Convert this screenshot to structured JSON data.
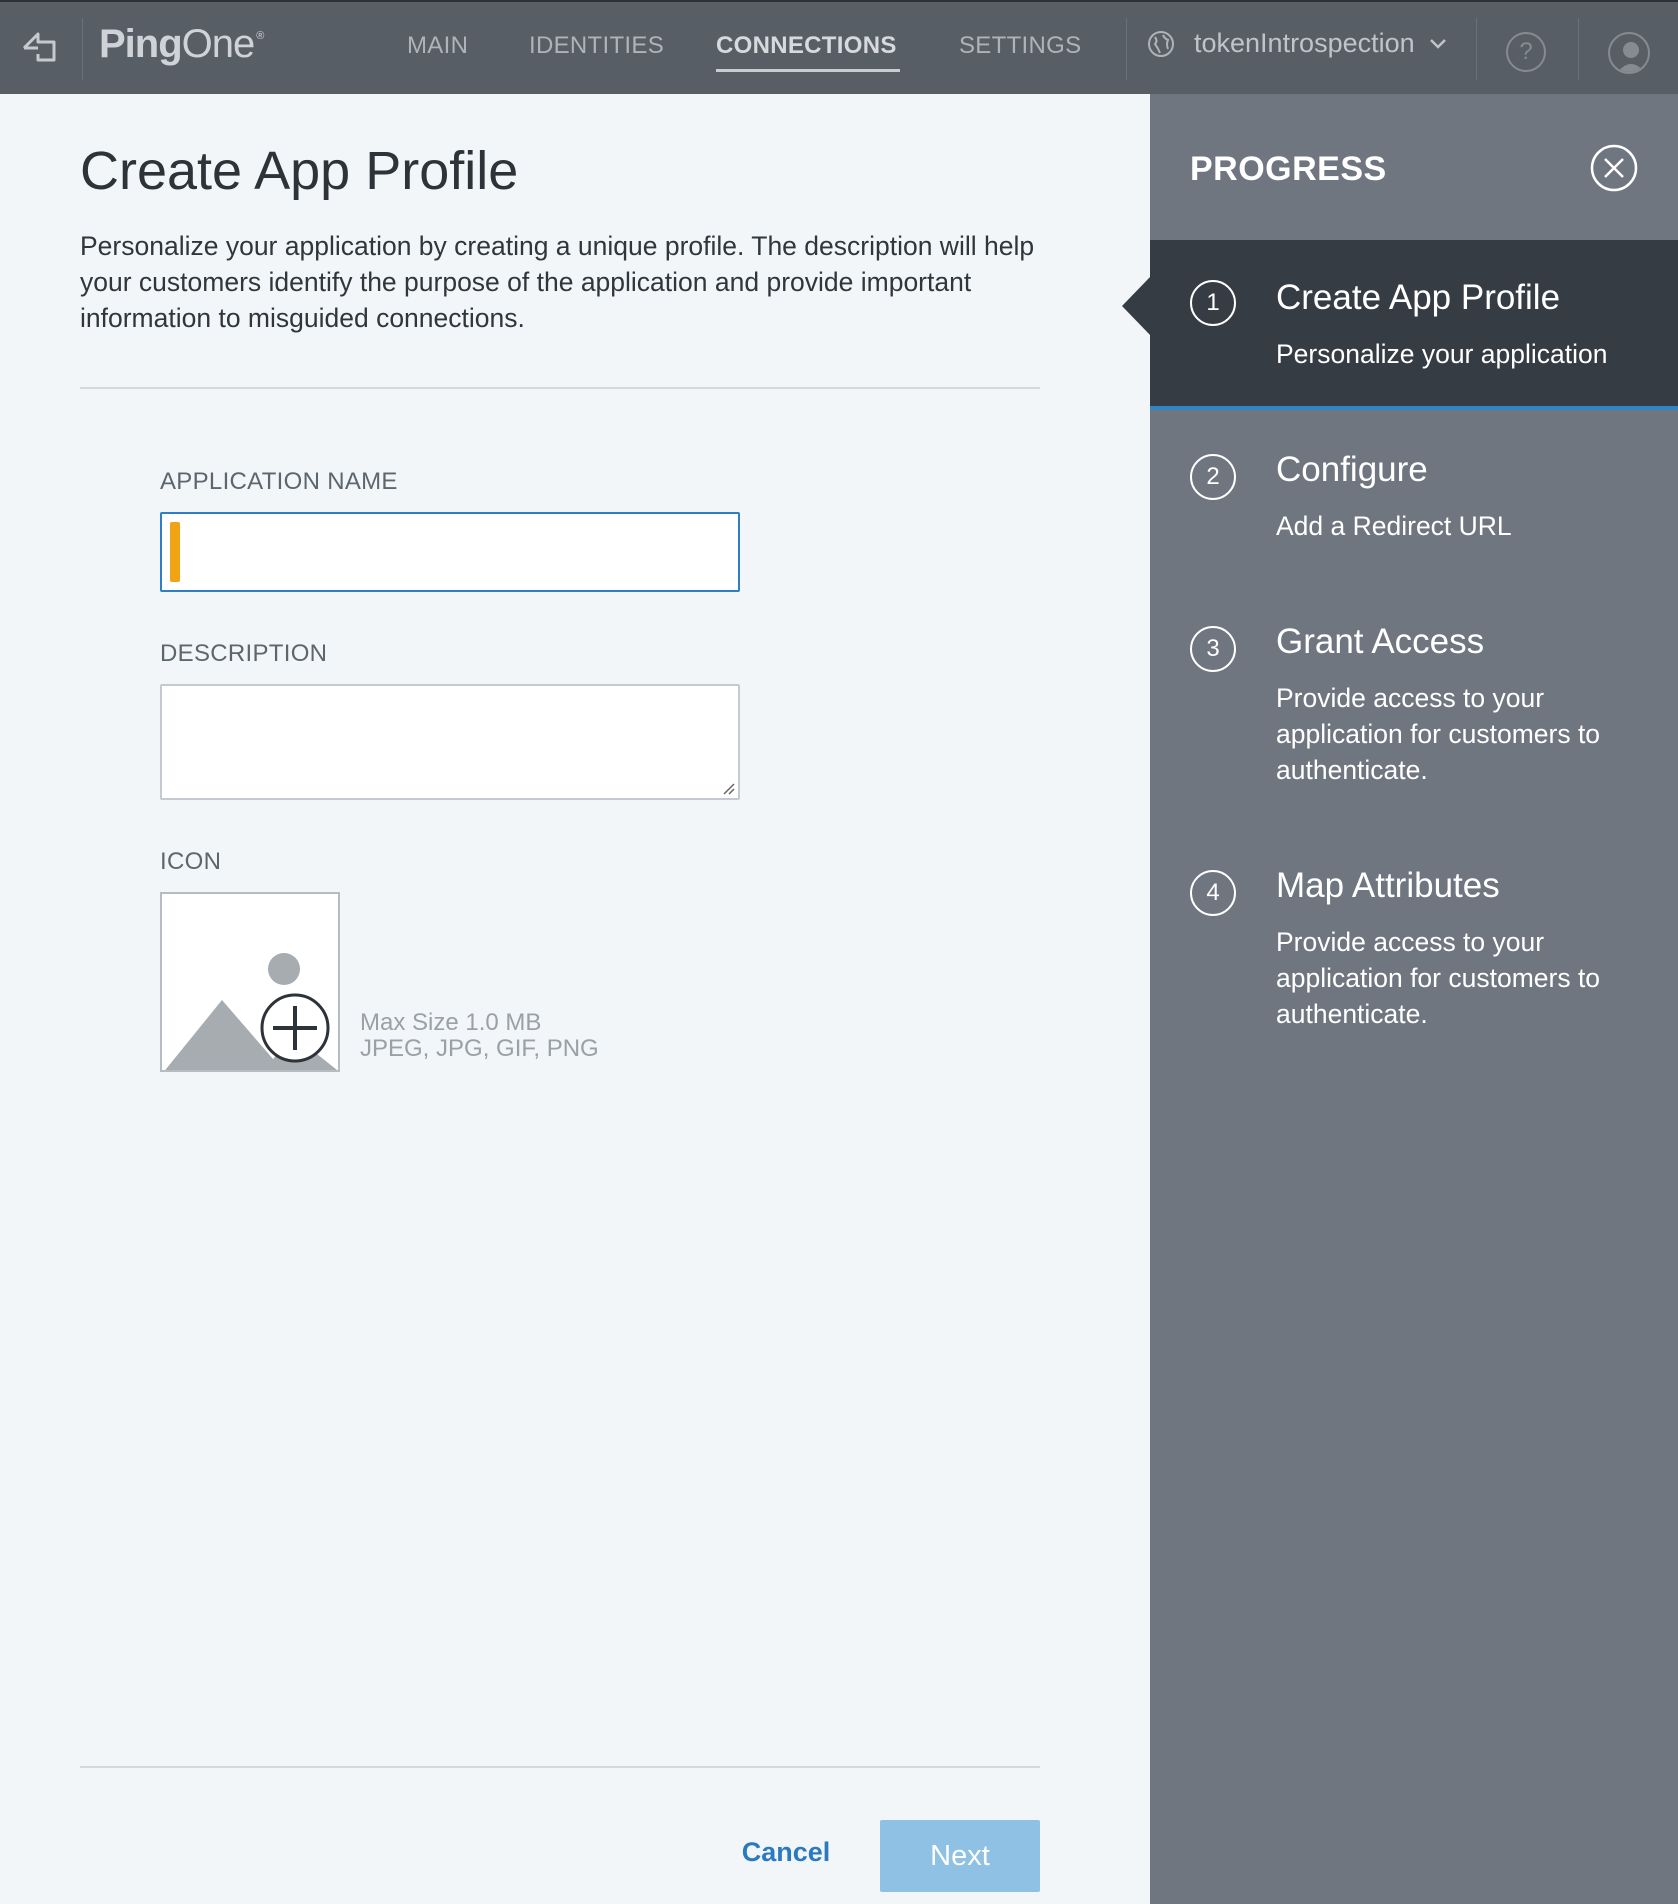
{
  "topbar": {
    "logo_ping": "Ping",
    "logo_one": "One",
    "logo_reg": "®",
    "nav": [
      {
        "label": "MAIN"
      },
      {
        "label": "IDENTITIES"
      },
      {
        "label": "CONNECTIONS",
        "active": true
      },
      {
        "label": "SETTINGS"
      }
    ],
    "environment": "tokenIntrospection",
    "help_label": "?"
  },
  "main": {
    "title": "Create App Profile",
    "description": "Personalize your application by creating a unique profile. The description will help your customers identify the purpose of the application and provide important information to misguided connections.",
    "app_name_label": "APPLICATION NAME",
    "app_name_value": "",
    "description_label": "DESCRIPTION",
    "description_value": "",
    "icon_label": "ICON",
    "icon_max_size": "Max Size 1.0 MB",
    "icon_formats": "JPEG, JPG, GIF, PNG",
    "cancel_label": "Cancel",
    "next_label": "Next"
  },
  "progress": {
    "title": "PROGRESS",
    "steps": [
      {
        "num": "1",
        "title": "Create App Profile",
        "subtitle": "Personalize your application",
        "active": true
      },
      {
        "num": "2",
        "title": "Configure",
        "subtitle": "Add a Redirect URL"
      },
      {
        "num": "3",
        "title": "Grant Access",
        "subtitle": "Provide access to your application for customers to authenticate."
      },
      {
        "num": "4",
        "title": "Map Attributes",
        "subtitle": "Provide access to your application for customers to authenticate."
      }
    ]
  },
  "colors": {
    "topbar": "#575e66",
    "panel": "#6f7680",
    "active_step": "#363c44",
    "accent": "#2e86c9",
    "required": "#f0a414",
    "next_button": "#8ec1e4"
  }
}
